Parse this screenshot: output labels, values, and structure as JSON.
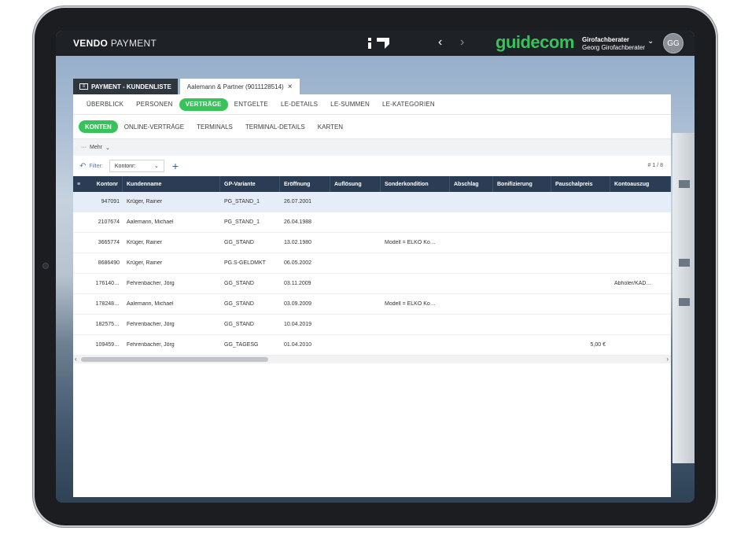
{
  "app": {
    "brand_bold": "VENDO",
    "brand_light": "PAYMENT",
    "logo_text": "guidecom",
    "user_role": "Girofachberater",
    "user_name": "Georg Girofachberater",
    "avatar_initials": "GG"
  },
  "tabs": [
    {
      "label": "PAYMENT - KUNDENLISTE",
      "active": false
    },
    {
      "label": "Aalemann & Partner (9011128514)",
      "active": true,
      "close": "×"
    }
  ],
  "nav_primary": [
    "ÜBERBLICK",
    "PERSONEN",
    "VERTRÄGE",
    "ENTGELTE",
    "LE-DETAILS",
    "LE-SUMMEN",
    "LE-KATEGORIEN"
  ],
  "nav_primary_active": "VERTRÄGE",
  "nav_secondary": [
    "KONTEN",
    "ONLINE-VERTRÄGE",
    "TERMINALS",
    "TERMINAL-DETAILS",
    "KARTEN"
  ],
  "nav_secondary_active": "KONTEN",
  "more": {
    "label": "Mehr"
  },
  "filter": {
    "label": "Filter:",
    "select_value": "Kontonr:",
    "page_count": "# 1 / 8"
  },
  "table": {
    "headers": [
      "Kontonr",
      "Kundenname",
      "GP-Variante",
      "Eröffnung",
      "Auflösung",
      "Sonderkondition",
      "Abschlag",
      "Bonifizierung",
      "Pauschalpreis",
      "Kontoauszug"
    ],
    "rows": [
      [
        "947091",
        "Krüger, Rainer",
        "PG_STAND_1",
        "26.07.2001",
        "",
        "",
        "",
        "",
        "",
        ""
      ],
      [
        "2107674",
        "Aalemann, Michael",
        "PG_STAND_1",
        "26.04.1988",
        "",
        "",
        "",
        "",
        "",
        ""
      ],
      [
        "3665774",
        "Krüger, Rainer",
        "GG_STAND",
        "13.02.1980",
        "",
        "Modell = ELKO Ko…",
        "",
        "",
        "",
        ""
      ],
      [
        "8686490",
        "Krüger, Rainer",
        "PG.S-GELDMKT",
        "06.05.2002",
        "",
        "",
        "",
        "",
        "",
        ""
      ],
      [
        "176140…",
        "Fehrenbacher, Jörg",
        "GG_STAND",
        "03.11.2009",
        "",
        "",
        "",
        "",
        "",
        "Abholer/KAD…"
      ],
      [
        "178248…",
        "Aalemann, Michael",
        "GG_STAND",
        "03.09.2009",
        "",
        "Modell = ELKO Ko…",
        "",
        "",
        "",
        ""
      ],
      [
        "182575…",
        "Fehrenbacher, Jörg",
        "GG_STAND",
        "10.04.2019",
        "",
        "",
        "",
        "",
        "",
        ""
      ],
      [
        "109459…",
        "Fehrenbacher, Jörg",
        "GG_TAGESG",
        "01.04.2010",
        "",
        "",
        "",
        "",
        "5,00 €",
        ""
      ]
    ]
  }
}
